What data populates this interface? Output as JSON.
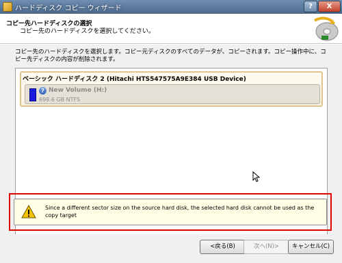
{
  "window": {
    "title": "ハードディスク コピー ウィザード",
    "help_label": "?",
    "close_label": "X"
  },
  "header": {
    "title": "コピー先ハードディスクの選択",
    "subtitle": "コピー先のハードディスクを選択してください。"
  },
  "main": {
    "description": "コピー先のハードディスクを選択します。コピー元ディスクのすべてのデータが、コピーされます。コピー操作中に、コピー先ディスクの内容が削除されます。",
    "disk": {
      "title": "ベーシック ハードディスク 2 (Hitachi HTS547575A9E384 USB Device)",
      "volume": {
        "name": "New Volume (H:)",
        "size": "698.6 GB NTFS",
        "color": "#1a1ae0",
        "icon": "question-icon"
      }
    }
  },
  "warning": {
    "icon": "warning-icon",
    "text": "Since a different sector size on the source hard disk, the selected hard disk cannot be used as the copy target",
    "highlight_color": "#e00000"
  },
  "footer": {
    "back_label": "<戻る(B)",
    "next_label": "次へ(N)>",
    "cancel_label": "キャンセル(C)"
  }
}
